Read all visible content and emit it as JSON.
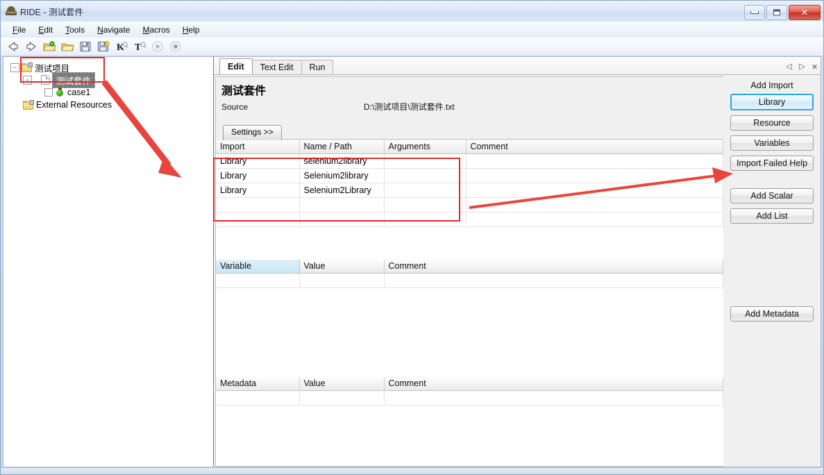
{
  "window": {
    "title": "RIDE - 测试套件",
    "icon": "robot-icon",
    "controls": {
      "minimize": "–",
      "maximize": "□",
      "close": "✕"
    }
  },
  "menubar": {
    "items": [
      {
        "label": "File",
        "accel": "F"
      },
      {
        "label": "Edit",
        "accel": "E"
      },
      {
        "label": "Tools",
        "accel": "T"
      },
      {
        "label": "Navigate",
        "accel": "N"
      },
      {
        "label": "Macros",
        "accel": "M"
      },
      {
        "label": "Help",
        "accel": "H"
      }
    ]
  },
  "toolbar": {
    "buttons": [
      {
        "name": "back-arrow-icon",
        "glyph": "⇦"
      },
      {
        "name": "forward-arrow-icon",
        "glyph": "⇨"
      },
      {
        "name": "open-folder-icon",
        "glyph": "folder-open"
      },
      {
        "name": "open-directory-icon",
        "glyph": "folder"
      },
      {
        "name": "save-icon",
        "glyph": "floppy"
      },
      {
        "name": "save-all-icon",
        "glyph": "floppy-star"
      },
      {
        "name": "search-keyword-icon",
        "glyph": "K"
      },
      {
        "name": "search-test-icon",
        "glyph": "T"
      },
      {
        "name": "run-icon",
        "glyph": "▶"
      },
      {
        "name": "stop-icon",
        "glyph": "●"
      }
    ]
  },
  "tree": {
    "nodes": [
      {
        "label": "测试项目",
        "icon": "project-folder-icon",
        "expander": "−",
        "depth": 0,
        "selected": false
      },
      {
        "label": "测试套件",
        "icon": "suite-file-icon",
        "expander": "−",
        "depth": 1,
        "selected": true
      },
      {
        "label": "case1",
        "icon": "test-case-icon",
        "expander": "",
        "depth": 2,
        "selected": false
      },
      {
        "label": "External Resources",
        "icon": "resources-folder-icon",
        "expander": "",
        "depth": 1,
        "selected": false
      }
    ]
  },
  "tabs": {
    "items": [
      {
        "label": "Edit",
        "active": true
      },
      {
        "label": "Text Edit",
        "active": false
      },
      {
        "label": "Run",
        "active": false
      }
    ],
    "controls": [
      {
        "name": "prev-tab-button",
        "glyph": "◁"
      },
      {
        "name": "next-tab-button",
        "glyph": "▷"
      },
      {
        "name": "close-tab-button",
        "glyph": "✕"
      }
    ]
  },
  "editor": {
    "suite_title": "测试套件",
    "source_label": "Source",
    "source_value": "D:\\测试项目\\测试套件.txt",
    "settings_button": "Settings >>"
  },
  "imports_table": {
    "headers": [
      "Import",
      "Name / Path",
      "Arguments",
      "Comment"
    ],
    "rows": [
      {
        "import": "Library",
        "name": "selenium2library",
        "arguments": "",
        "comment": "",
        "error": true
      },
      {
        "import": "Library",
        "name": "Selenium2library",
        "arguments": "",
        "comment": "",
        "error": true
      },
      {
        "import": "Library",
        "name": "Selenium2Library",
        "arguments": "",
        "comment": "",
        "error": false
      },
      {
        "import": "",
        "name": "",
        "arguments": "",
        "comment": "",
        "error": false
      },
      {
        "import": "",
        "name": "",
        "arguments": "",
        "comment": "",
        "error": false
      }
    ]
  },
  "variables_table": {
    "headers": [
      "Variable",
      "Value",
      "Comment"
    ],
    "rows": []
  },
  "metadata_table": {
    "headers": [
      "Metadata",
      "Value",
      "Comment"
    ],
    "rows": []
  },
  "side_panel": {
    "add_import_label": "Add Import",
    "import_buttons": [
      {
        "label": "Library",
        "focused": true
      },
      {
        "label": "Resource",
        "focused": false
      },
      {
        "label": "Variables",
        "focused": false
      },
      {
        "label": "Import Failed Help",
        "focused": false
      }
    ],
    "variable_buttons": [
      {
        "label": "Add Scalar"
      },
      {
        "label": "Add List"
      }
    ],
    "metadata_button": {
      "label": "Add Metadata"
    }
  },
  "annotations": {
    "color": "#e0292a",
    "boxes": [
      {
        "name": "tree-selection-highlight-box"
      },
      {
        "name": "imports-table-highlight-box"
      }
    ],
    "arrows": [
      {
        "name": "tree-to-imports-arrow"
      },
      {
        "name": "imports-to-library-button-arrow"
      }
    ]
  }
}
